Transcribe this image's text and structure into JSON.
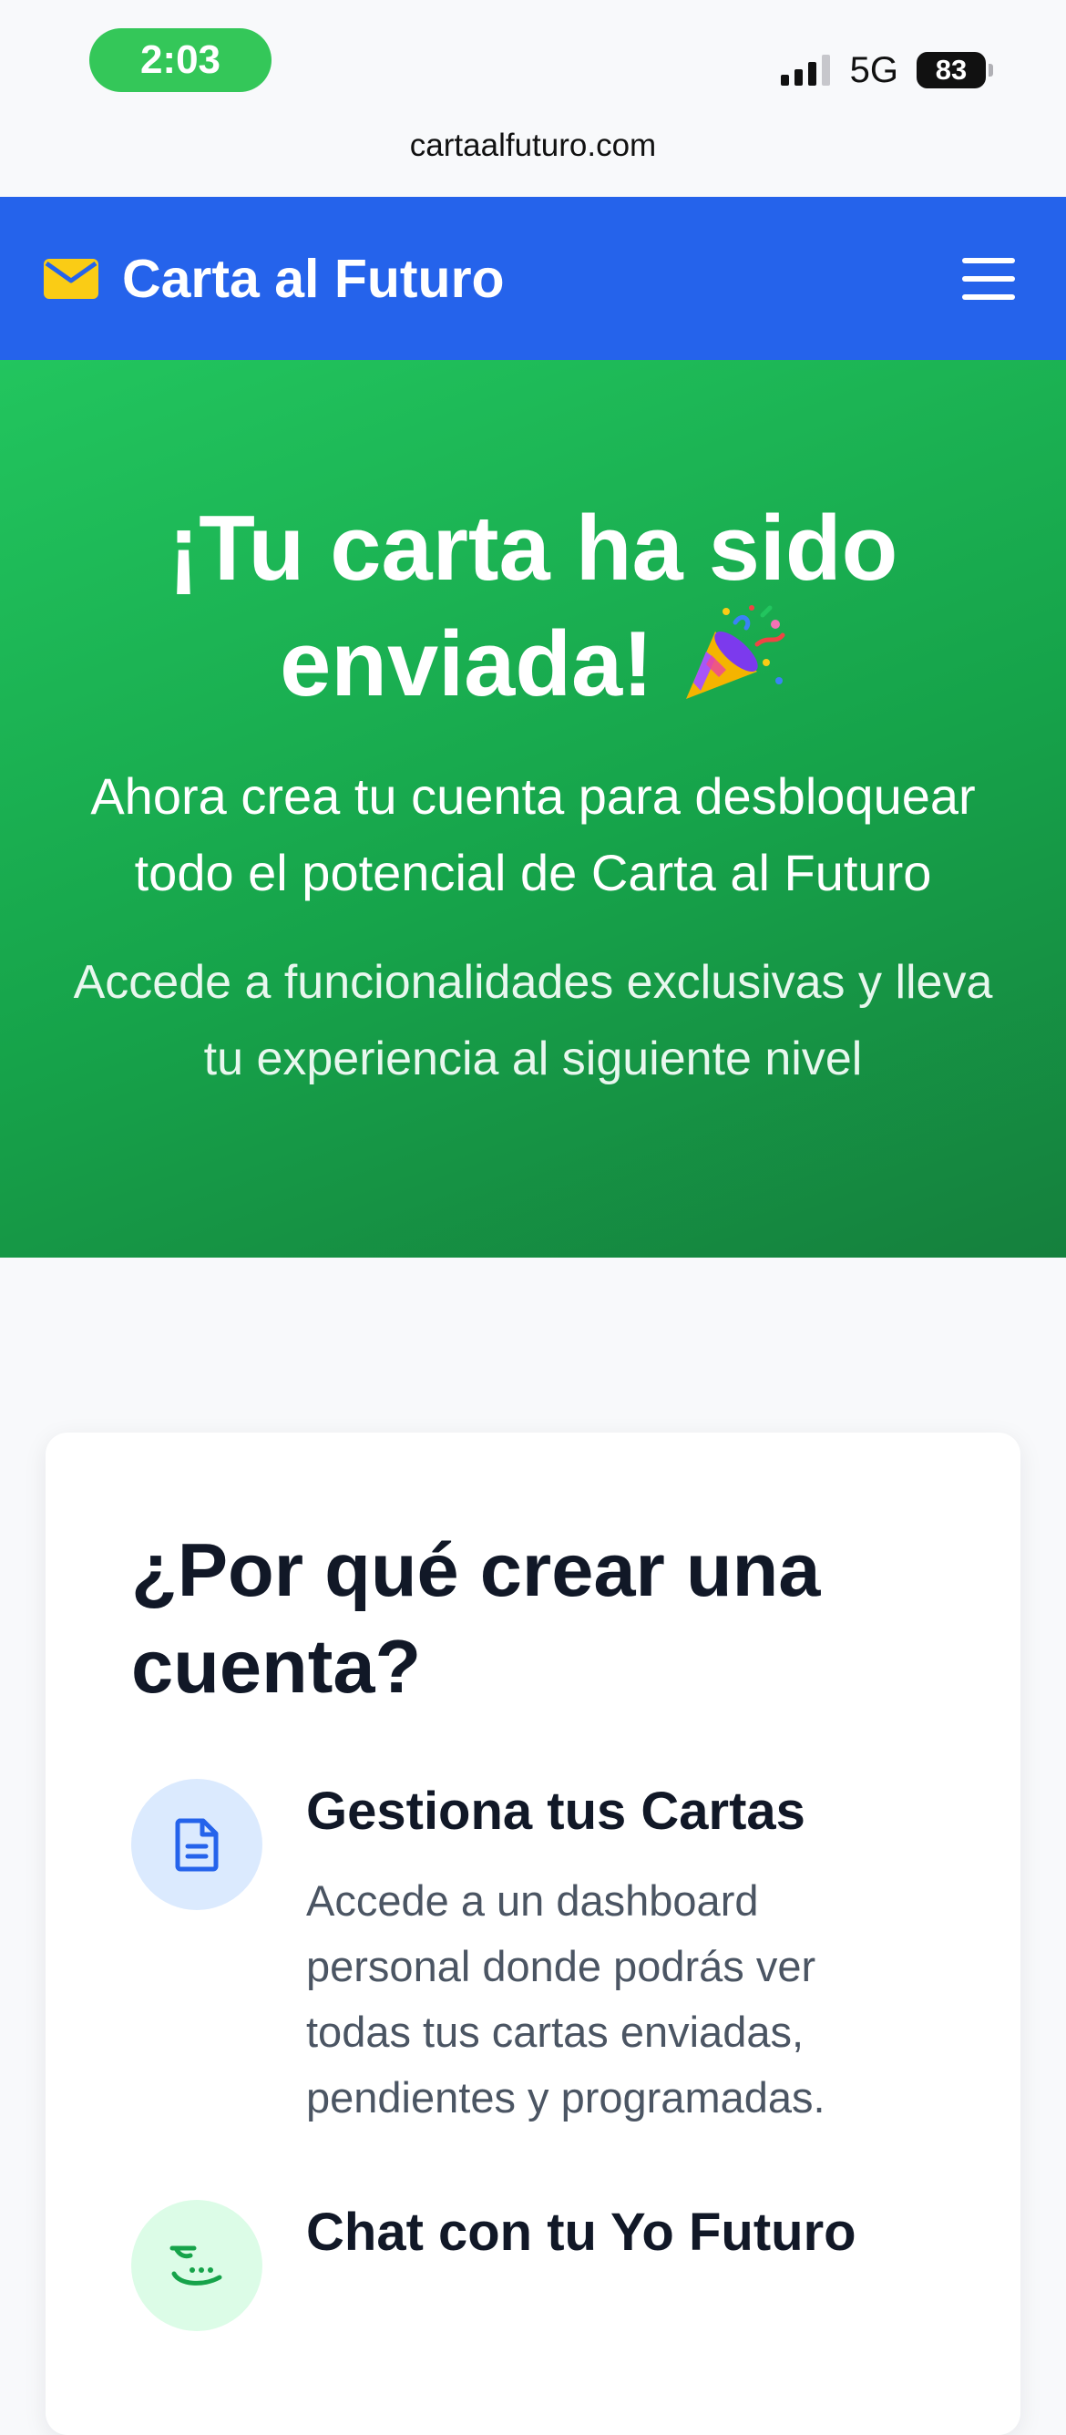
{
  "status_bar": {
    "time": "2:03",
    "network": "5G",
    "battery": "83",
    "url": "cartaalfuturo.com"
  },
  "navbar": {
    "brand": "Carta al Futuro",
    "brand_icon": "envelope-icon",
    "menu_icon": "hamburger-menu-icon"
  },
  "hero": {
    "title": "¡Tu carta ha sido enviada!",
    "title_icon": "party-popper-icon",
    "subtitle": "Ahora crea tu cuenta para desbloquear todo el potencial de Carta al Futuro",
    "text": "Accede a funcionalidades exclusivas y lleva tu experiencia al siguiente nivel"
  },
  "benefits": {
    "title": "¿Por qué crear una cuenta?",
    "features": [
      {
        "icon": "document-icon",
        "title": "Gestiona tus Cartas",
        "text": "Accede a un dashboard personal donde podrás ver todas tus cartas enviadas, pendientes y programadas."
      },
      {
        "icon": "chat-bubble-icon",
        "title": "Chat con tu Yo Futuro",
        "text": ""
      }
    ]
  },
  "colors": {
    "primary": "#2563eb",
    "hero_green": "#16a34a",
    "brand_icon": "#facc15",
    "status_pill": "#34c759"
  }
}
